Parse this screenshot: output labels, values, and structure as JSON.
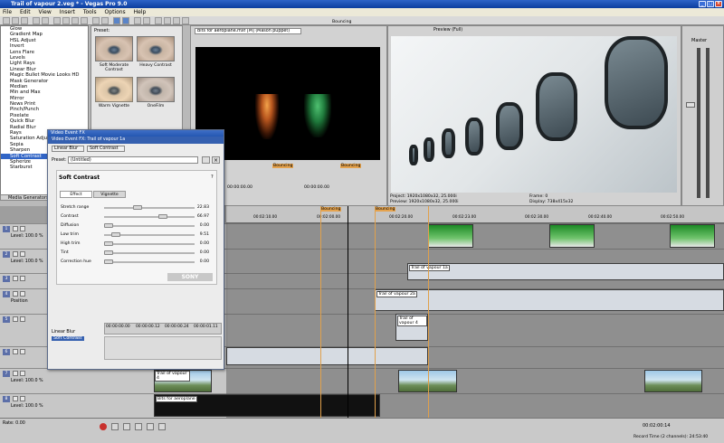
{
  "window": {
    "title": "Trail of vapour 2.veg * - Vegas Pro 9.0"
  },
  "menu": [
    "File",
    "Edit",
    "View",
    "Insert",
    "Tools",
    "Options",
    "Help"
  ],
  "effects_list": [
    "Glow",
    "Gradient Map",
    "HSL Adjust",
    "Invert",
    "Lens Flare",
    "Levels",
    "Light Rays",
    "Linear Blur",
    "Magic Bullet Movie Looks HD",
    "Mask Generator",
    "Median",
    "Min and Max",
    "Mirror",
    "News Print",
    "Pinch/Punch",
    "Pixelate",
    "Quick Blur",
    "Radial Blur",
    "Rays",
    "Saturation Adjust",
    "Sepia",
    "Sharpen",
    "Soft Contrast",
    "Spherize",
    "Starburst"
  ],
  "effects_selected": "Soft Contrast",
  "left_tab": "Media Generators",
  "preset_panel": {
    "label": "Preset:",
    "items": [
      "Soft Moderate Contrast",
      "Heavy Contrast",
      "Warm Vignette",
      "OneFilm"
    ]
  },
  "trimmer": {
    "file": "Bits for aeroplane.mxf",
    "mode": "[M] (Mason puppet)",
    "timecode_left": "00:00:00.00",
    "timecode_right": "00:00:00.00",
    "markers": [
      "Bouncing",
      "Bouncing",
      "Bouncing"
    ]
  },
  "preview": {
    "mode": "Preview (Full)",
    "project": "Project: 1920x1080x32, 25.000i",
    "preview_res": "Preview: 1920x1080x32, 25.000i",
    "frame_label": "Frame:",
    "frame": "0",
    "display": "Display: 738x415x32"
  },
  "mixer": {
    "label": "Master",
    "scale": [
      "3",
      "9",
      "15",
      "21",
      "27",
      "33",
      "39",
      "45",
      "51",
      "57"
    ],
    "bottom": "0.0  0.0"
  },
  "dialog": {
    "title": "Video Event FX",
    "header": "Video Event FX: Trail of vapour 1a",
    "chain": [
      "Linear Blur",
      "Soft Contrast"
    ],
    "preset_label": "Preset:",
    "preset_value": "(Untitled)",
    "plugin": "Soft Contrast",
    "help": "?",
    "tabs": [
      "Effect",
      "Vignette"
    ],
    "brand": "SONY",
    "params": [
      {
        "label": "Stretch range",
        "value": "22.83",
        "pos": 0.35
      },
      {
        "label": "Contrast",
        "value": "66.97",
        "pos": 0.67
      },
      {
        "label": "Diffusion",
        "value": "0.00",
        "pos": 0.0
      },
      {
        "label": "Low trim",
        "value": "9.51",
        "pos": 0.09
      },
      {
        "label": "High trim",
        "value": "0.00",
        "pos": 0.0
      },
      {
        "label": "Tint",
        "value": "0.00",
        "pos": 0.0
      },
      {
        "label": "Correction hue",
        "value": "0.00",
        "pos": 0.0
      }
    ],
    "kf_times": [
      "00:00:00.00",
      "00:00:00.12",
      "00:00:00.24",
      "00:00:01.11"
    ]
  },
  "timeline": {
    "marker_labels": [
      "Bouncing",
      "Bouncing"
    ],
    "ruler": [
      "00:02:23.00",
      "00:02:00.00",
      "00:02:10.00",
      "00:02:20.00",
      "00:02:23.00",
      "00:02:30.00",
      "00:02:40.00",
      "00:02:50.00",
      "00:03:00.00",
      "00:03:10.00",
      "00:03:20.00"
    ],
    "tracks": [
      {
        "num": "1",
        "level": "Level: 100.0 %"
      },
      {
        "num": "2",
        "level": "Level: 100.0 %"
      },
      {
        "num": "3",
        "level": ""
      },
      {
        "num": "4",
        "level": "Position"
      },
      {
        "num": "5",
        "level": ""
      },
      {
        "num": "6",
        "level": ""
      },
      {
        "num": "7",
        "level": "Level: 100.0 %"
      },
      {
        "num": "8",
        "level": "Level: 100.0 %"
      }
    ],
    "events": [
      "Trail of vapour 1a",
      "Trail of vapour 2a",
      "Trail of vapour 4",
      "Trail of vapour 4",
      "Bits for aeroplane",
      "Bouncing",
      "Bouncing"
    ]
  },
  "status": {
    "rate": "Rate: 0.00",
    "timecode": "00:02:00:14",
    "record": "Record Time (2 channels): 24:53:40"
  }
}
